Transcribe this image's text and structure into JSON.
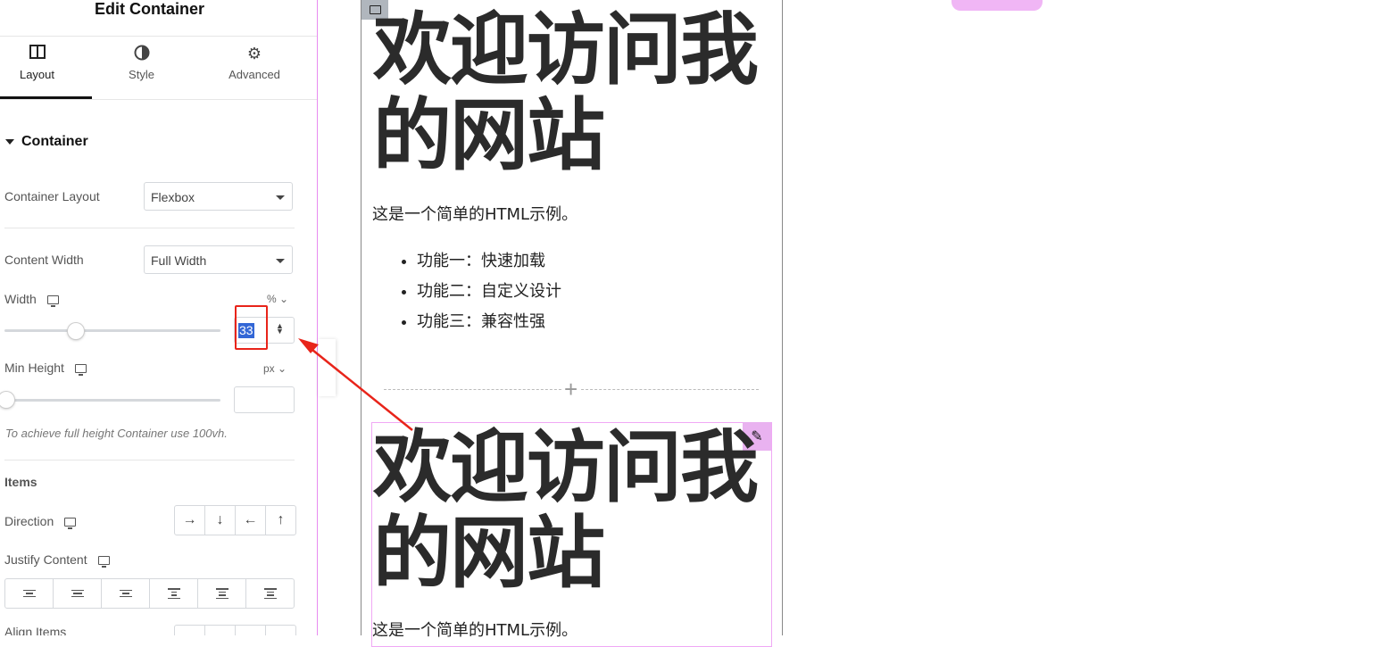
{
  "panel": {
    "title": "Edit Container",
    "tabs": [
      {
        "label": "Layout",
        "icon": "layout-icon",
        "active": true
      },
      {
        "label": "Style",
        "icon": "half-circle-icon"
      },
      {
        "label": "Advanced",
        "icon": "gear-icon"
      }
    ],
    "section": "Container",
    "container_layout": {
      "label": "Container Layout",
      "value": "Flexbox"
    },
    "content_width": {
      "label": "Content Width",
      "value": "Full Width"
    },
    "width": {
      "label": "Width",
      "unit": "%",
      "value": "33",
      "slider_level_percent": 33
    },
    "min_height": {
      "label": "Min Height",
      "unit": "px",
      "value": ""
    },
    "hint": "To achieve full height Container use 100vh.",
    "items_heading": "Items",
    "direction": {
      "label": "Direction",
      "options": [
        "→",
        "↓",
        "←",
        "↑"
      ]
    },
    "justify_content": {
      "label": "Justify Content"
    },
    "align_items_partial": {
      "label": "Align Items"
    }
  },
  "canvas": {
    "heading_line1": "欢迎访问我",
    "heading_line2": "的网站",
    "paragraph": "这是一个简单的HTML示例。",
    "features": [
      "功能一：快速加载",
      "功能二：自定义设计",
      "功能三：兼容性强"
    ]
  },
  "colors": {
    "accent_pink": "#e9b2f0",
    "annotation_red": "#e8241a",
    "selection_blue": "#3367d6"
  }
}
